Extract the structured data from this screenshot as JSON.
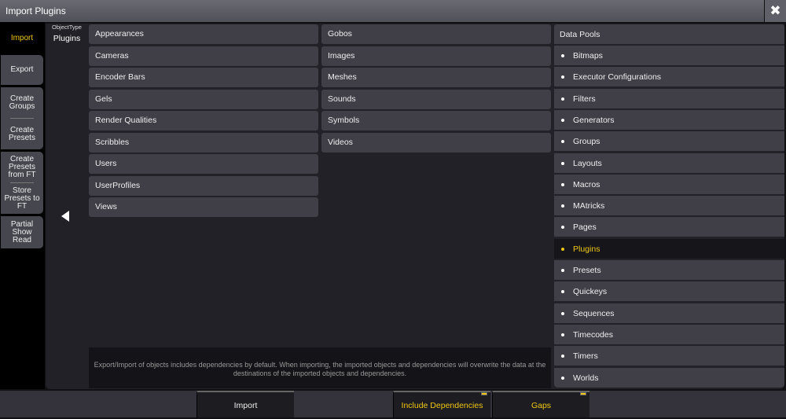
{
  "window": {
    "title": "Import Plugins",
    "close_icon": "close-x-icon"
  },
  "sidebar": {
    "import": "Import",
    "export": "Export",
    "create_groups": "Create Groups",
    "create_presets": "Create Presets",
    "create_presets_ft": "Create Presets from FT",
    "store_presets_ft": "Store Presets to FT",
    "partial_show_read": "Partial Show Read"
  },
  "object_type": {
    "label": "ObjectType",
    "value": "Plugins"
  },
  "column1": [
    "Appearances",
    "Cameras",
    "Encoder Bars",
    "Gels",
    "Render Qualities",
    "Scribbles",
    "Users",
    "UserProfiles",
    "Views"
  ],
  "column2": [
    "Gobos",
    "Images",
    "Meshes",
    "Sounds",
    "Symbols",
    "Videos"
  ],
  "data_pools": {
    "header": "Data Pools",
    "items": [
      "Bitmaps",
      "Executor Configurations",
      "Filters",
      "Generators",
      "Groups",
      "Layouts",
      "Macros",
      "MAtricks",
      "Pages",
      "Plugins",
      "Presets",
      "Quickeys",
      "Sequences",
      "Timecodes",
      "Timers",
      "Worlds"
    ],
    "selected": "Plugins"
  },
  "info": "Export/Import of objects includes dependencies by default. When importing, the imported objects and dependencies will overwrite the data at the destinations of the imported objects and dependencies.",
  "bottom": {
    "import": "Import",
    "include_dependencies": "Include Dependencies",
    "gaps": "Gaps"
  },
  "colors": {
    "accent": "#e8c21a"
  }
}
